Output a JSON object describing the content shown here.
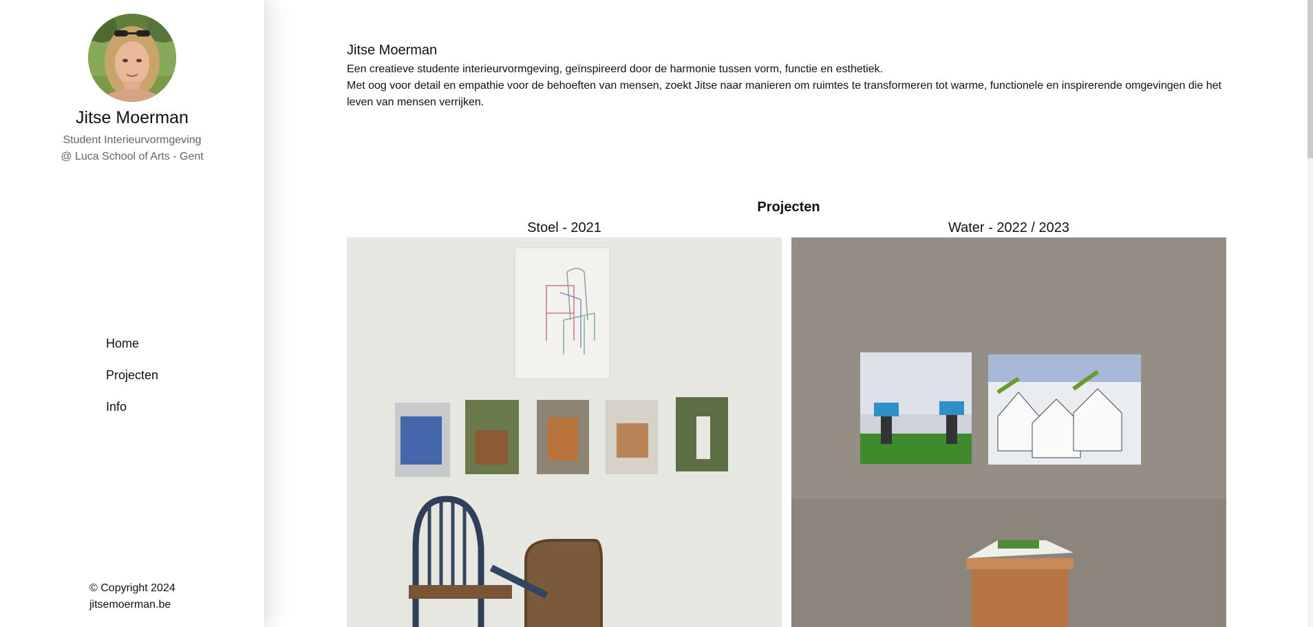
{
  "profile": {
    "name": "Jitse Moerman",
    "subtitle_line1": "Student Interieurvormgeving",
    "subtitle_line2": "@ Luca School of Arts - Gent"
  },
  "nav": {
    "items": [
      {
        "label": "Home"
      },
      {
        "label": "Projecten"
      },
      {
        "label": "Info"
      }
    ]
  },
  "footer": {
    "copyright": "© Copyright 2024",
    "site": "jitsemoerman.be"
  },
  "intro": {
    "title": "Jitse Moerman",
    "line1": "Een creatieve studente interieurvormgeving, geïnspireerd door de harmonie tussen vorm, functie en esthetiek.",
    "line2": "Met oog voor detail en empathie voor de behoeften van mensen, zoekt Jitse naar manieren om ruimtes te transformeren tot warme, functionele en inspirerende omgevingen die het leven van mensen verrijken."
  },
  "projects": {
    "heading": "Projecten",
    "items": [
      {
        "title": "Stoel - 2021"
      },
      {
        "title": "Water - 2022 / 2023"
      }
    ]
  }
}
